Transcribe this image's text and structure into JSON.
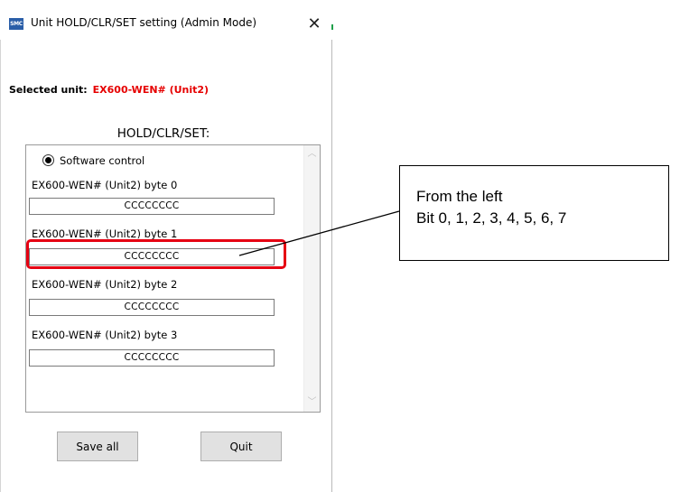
{
  "window": {
    "title": "Unit HOLD/CLR/SET setting (Admin Mode)",
    "app_icon_text": "SMC",
    "close_glyph": "✕"
  },
  "selected_unit": {
    "label": "Selected unit:",
    "value": "EX600-WEN# (Unit2)",
    "value_color": "#e60000"
  },
  "group": {
    "title": "HOLD/CLR/SET:",
    "radio_label": "Software control",
    "radio_checked": true,
    "bytes": [
      {
        "label": "EX600-WEN# (Unit2)  byte 0",
        "value": "CCCCCCCC"
      },
      {
        "label": "EX600-WEN# (Unit2)  byte 1",
        "value": "CCCCCCCC"
      },
      {
        "label": "EX600-WEN# (Unit2)  byte 2",
        "value": "CCCCCCCC"
      },
      {
        "label": "EX600-WEN# (Unit2)  byte 3",
        "value": "CCCCCCCC"
      }
    ]
  },
  "buttons": {
    "save_label": "Save all",
    "quit_label": "Quit"
  },
  "annotation": {
    "line1": "From the left",
    "line2": "Bit 0, 1, 2, 3, 4, 5, 6, 7",
    "highlight_color": "#e60012"
  }
}
